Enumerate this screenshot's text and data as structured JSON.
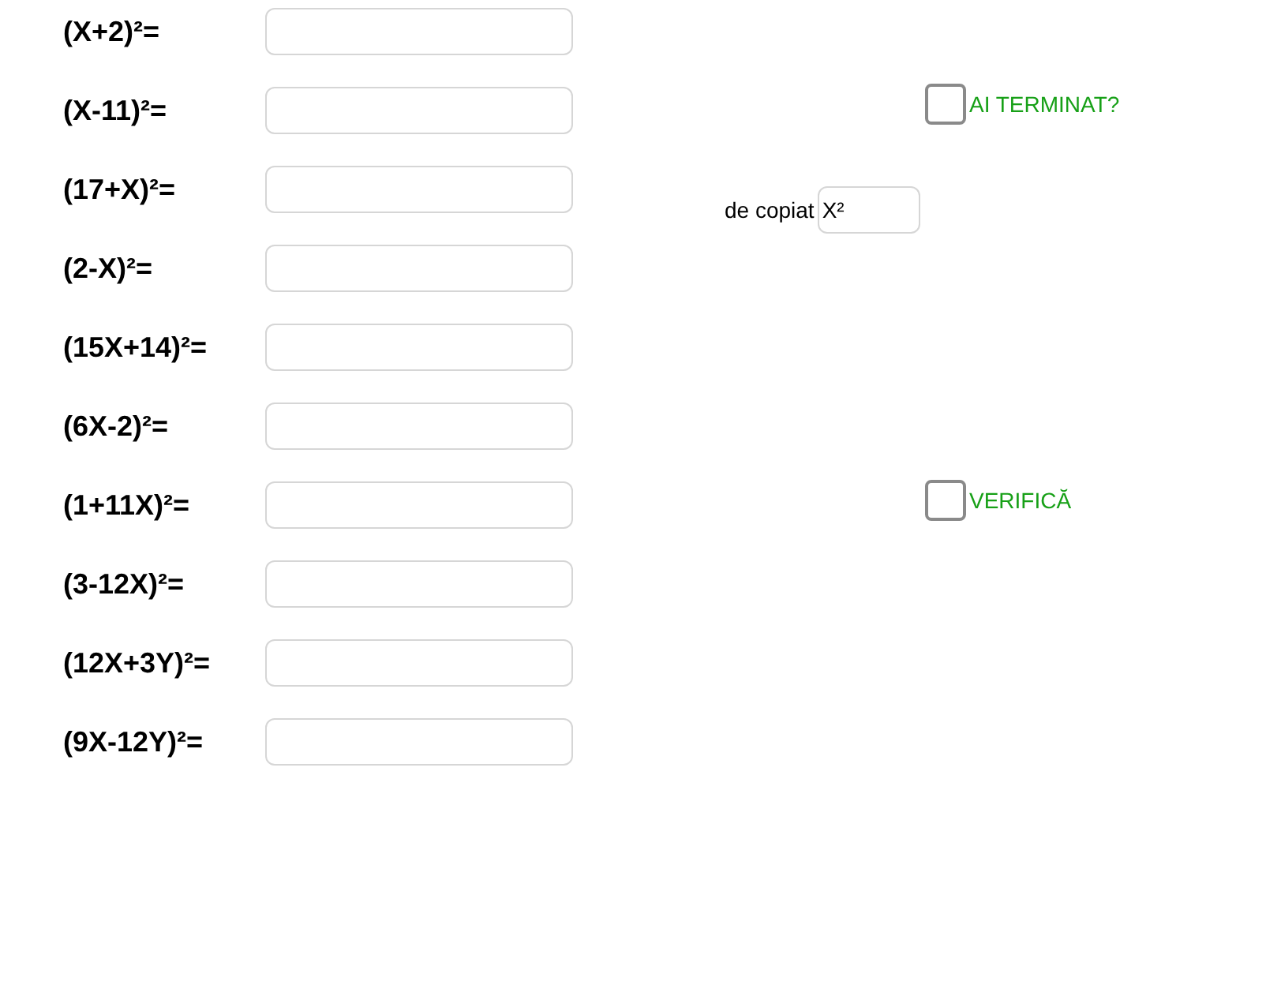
{
  "exercises": [
    {
      "label": "(X+2)²="
    },
    {
      "label": "(X-11)²="
    },
    {
      "label": "(17+X)²="
    },
    {
      "label": "(2-X)²="
    },
    {
      "label": "(15X+14)²="
    },
    {
      "label": "(6X-2)²="
    },
    {
      "label": "(1+11X)²="
    },
    {
      "label": "(3-12X)²="
    },
    {
      "label": "(12X+3Y)²="
    },
    {
      "label": "(9X-12Y)²="
    }
  ],
  "finished_checkbox": {
    "label": "AI TERMINAT?",
    "checked": false
  },
  "copy_field": {
    "label": "de copiat",
    "value": "X²"
  },
  "verify_checkbox": {
    "label": "VERIFICĂ",
    "checked": false
  }
}
